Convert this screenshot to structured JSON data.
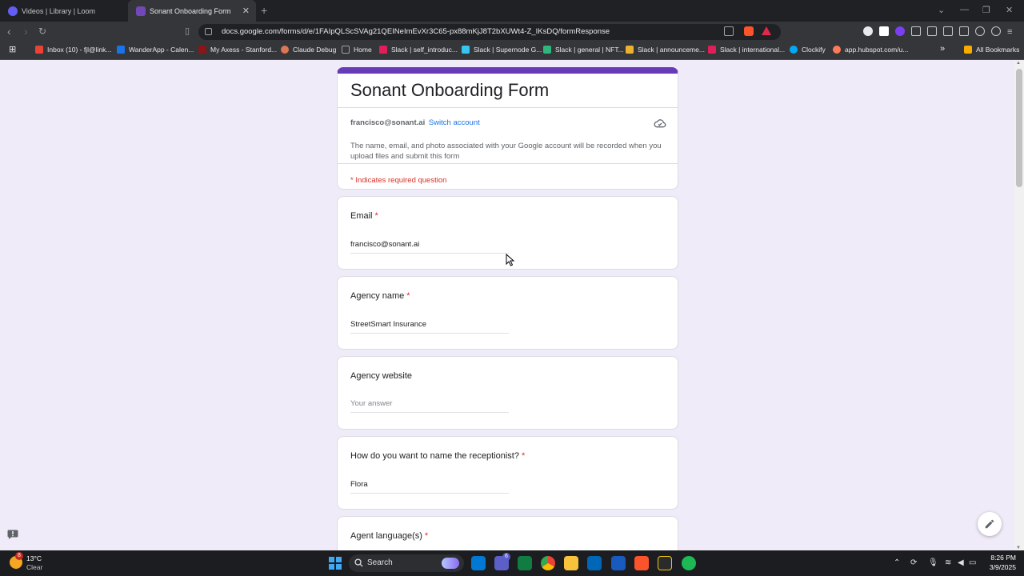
{
  "browser": {
    "tabs": [
      {
        "title": "Videos | Library | Loom",
        "active": false
      },
      {
        "title": "Sonant Onboarding Form",
        "active": true
      }
    ],
    "url": "docs.google.com/forms/d/e/1FAIpQLScSVAg21QEINeImEvXr3C65-px88mKjJ8T2bXUWt4-Z_IKsDQ/formResponse",
    "bookmarks": [
      "Inbox (10) - fjl@link...",
      "WanderApp - Calen...",
      "My Axess - Stanford...",
      "Claude Debug",
      "Home",
      "Slack | self_introduc...",
      "Slack | Supernode G...",
      "Slack | general | NFT...",
      "Slack | announceme...",
      "Slack | international...",
      "Clockify",
      "app.hubspot.com/u...",
      "All Bookmarks"
    ]
  },
  "form": {
    "title": "Sonant Onboarding Form",
    "account_email": "francisco@sonant.ai",
    "switch_account": "Switch account",
    "notice": "The name, email, and photo associated with your Google account will be recorded when you upload files and submit this form",
    "required_note": "* Indicates required question",
    "questions": [
      {
        "label": "Email",
        "required": "*",
        "answer": "francisco@sonant.ai"
      },
      {
        "label": "Agency name",
        "required": "*",
        "answer": "StreetSmart Insurance"
      },
      {
        "label": "Agency website",
        "required": "",
        "placeholder": "Your answer"
      },
      {
        "label": "How do you want to name the receptionist?",
        "required": "*",
        "answer": "Flora"
      },
      {
        "label": "Agent language(s)",
        "required": "*"
      }
    ]
  },
  "taskbar": {
    "weather_temp": "13°C",
    "weather_cond": "Clear",
    "weather_badge": "8",
    "search_label": "Search",
    "teams_badge": "6",
    "time": "8:26 PM",
    "date": "3/9/2025"
  },
  "colors": {
    "form_accent": "#673ab7",
    "required_red": "#d93025",
    "link_blue": "#1a73e8",
    "page_bg": "#f0ebf8"
  }
}
